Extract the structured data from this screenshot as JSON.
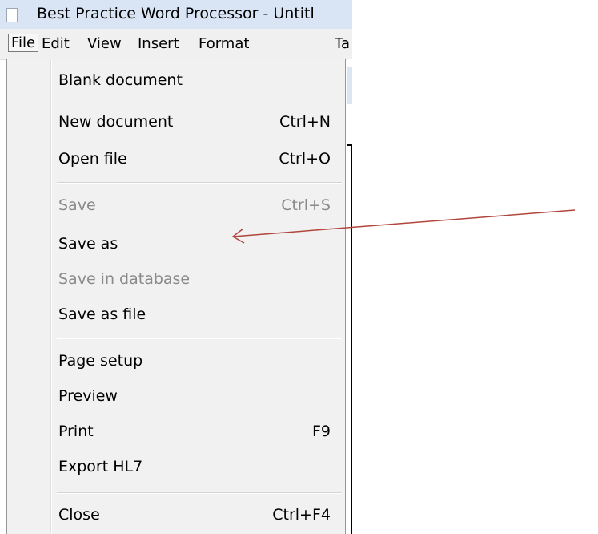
{
  "window": {
    "title": "Best Practice Word Processor - Untitl"
  },
  "menubar": {
    "items": [
      {
        "label": "File"
      },
      {
        "label": "Edit"
      },
      {
        "label": "View"
      },
      {
        "label": "Insert"
      },
      {
        "label": "Format"
      },
      {
        "label": "Ta"
      }
    ]
  },
  "file_menu": {
    "items": [
      {
        "label": "Blank document",
        "shortcut": ""
      },
      {
        "label": "New document",
        "shortcut": "Ctrl+N"
      },
      {
        "label": "Open file",
        "shortcut": "Ctrl+O"
      },
      {
        "label": "Save",
        "shortcut": "Ctrl+S",
        "disabled": true
      },
      {
        "label": "Save as",
        "shortcut": ""
      },
      {
        "label": "Save in database",
        "shortcut": "",
        "disabled": true
      },
      {
        "label": "Save as file",
        "shortcut": ""
      },
      {
        "label": "Page setup",
        "shortcut": ""
      },
      {
        "label": "Preview",
        "shortcut": ""
      },
      {
        "label": "Print",
        "shortcut": "F9"
      },
      {
        "label": "Export HL7",
        "shortcut": ""
      },
      {
        "label": "Close",
        "shortcut": "Ctrl+F4"
      }
    ]
  },
  "annotation": {
    "arrow_color": "#b0463c"
  }
}
